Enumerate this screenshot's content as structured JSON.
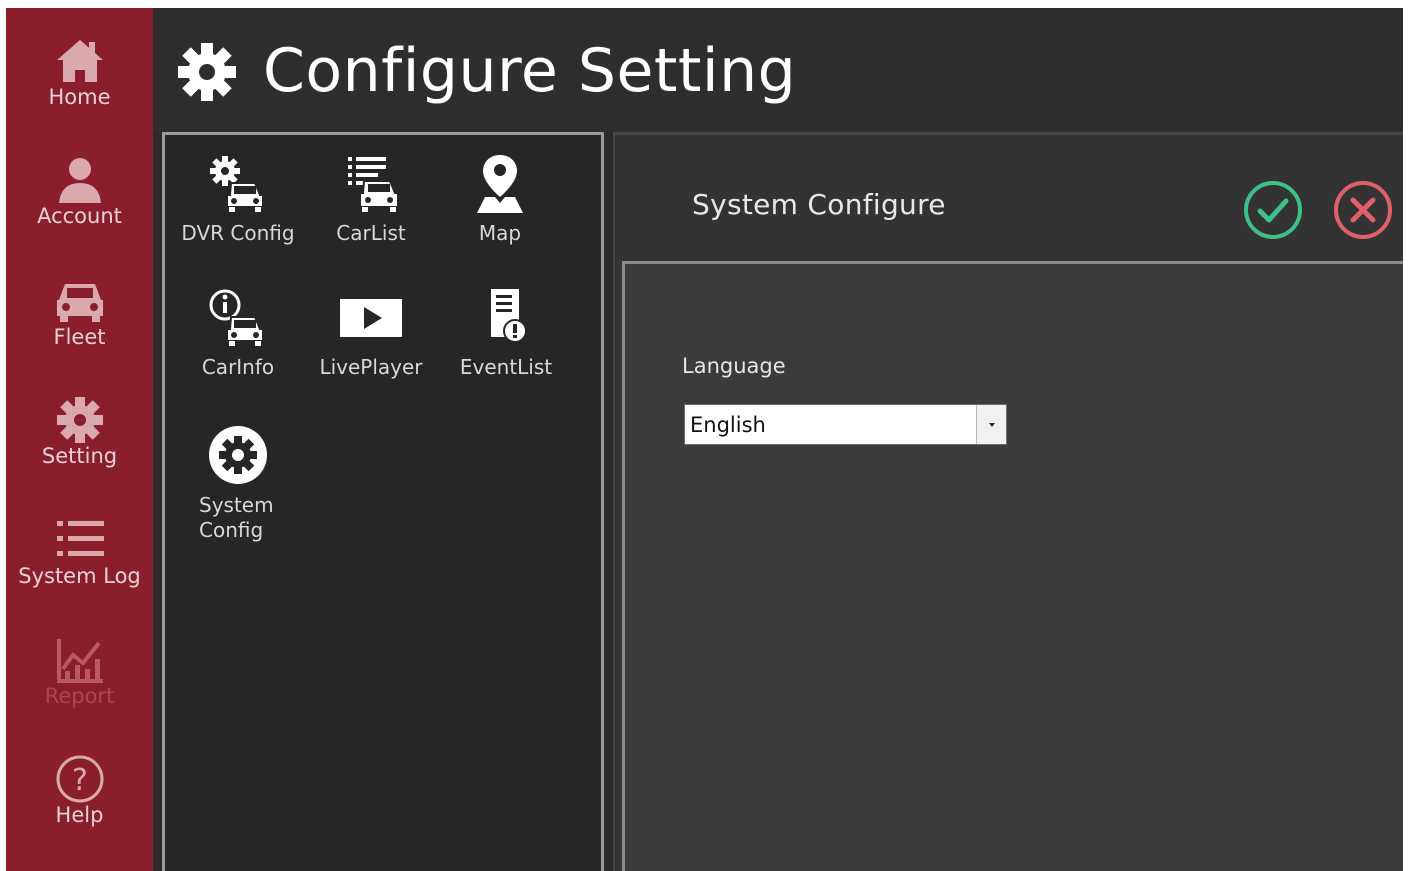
{
  "header": {
    "title": "Configure Setting"
  },
  "sidebar": {
    "items": [
      {
        "label": "Home",
        "icon": "home-icon"
      },
      {
        "label": "Account",
        "icon": "user-icon"
      },
      {
        "label": "Fleet",
        "icon": "car-icon"
      },
      {
        "label": "Setting",
        "icon": "gear-icon"
      },
      {
        "label": "System Log",
        "icon": "list-icon"
      },
      {
        "label": "Report",
        "icon": "chart-icon",
        "disabled": true
      },
      {
        "label": "Help",
        "icon": "help-icon"
      }
    ]
  },
  "modules": [
    {
      "label": "DVR Config",
      "icon": "dvr-config-icon"
    },
    {
      "label": "CarList",
      "icon": "carlist-icon"
    },
    {
      "label": "Map",
      "icon": "map-pin-icon"
    },
    {
      "label": "CarInfo",
      "icon": "carinfo-icon"
    },
    {
      "label": "LivePlayer",
      "icon": "play-icon"
    },
    {
      "label": "EventList",
      "icon": "eventlist-icon"
    },
    {
      "label_line1": "System",
      "label_line2": "Config",
      "icon": "system-config-icon"
    }
  ],
  "config": {
    "title": "System Configure",
    "confirm_icon": "check-icon",
    "cancel_icon": "close-icon",
    "language_label": "Language",
    "language_value": "English"
  },
  "colors": {
    "sidebar": "#8a1f2b",
    "confirm": "#3fbf8a",
    "cancel": "#e0606a"
  }
}
